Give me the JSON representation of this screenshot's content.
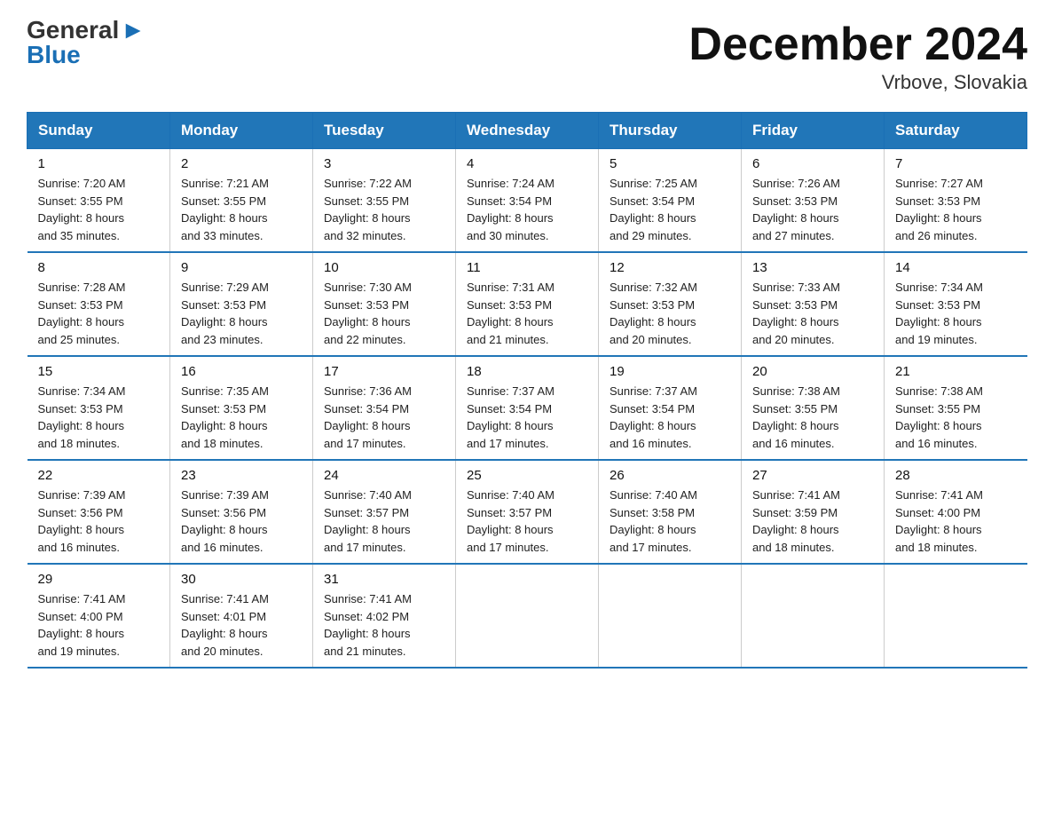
{
  "header": {
    "logo_general": "General",
    "logo_blue": "Blue",
    "month_title": "December 2024",
    "location": "Vrbove, Slovakia"
  },
  "days_of_week": [
    "Sunday",
    "Monday",
    "Tuesday",
    "Wednesday",
    "Thursday",
    "Friday",
    "Saturday"
  ],
  "weeks": [
    [
      {
        "day": "1",
        "sunrise": "7:20 AM",
        "sunset": "3:55 PM",
        "daylight": "8 hours and 35 minutes."
      },
      {
        "day": "2",
        "sunrise": "7:21 AM",
        "sunset": "3:55 PM",
        "daylight": "8 hours and 33 minutes."
      },
      {
        "day": "3",
        "sunrise": "7:22 AM",
        "sunset": "3:55 PM",
        "daylight": "8 hours and 32 minutes."
      },
      {
        "day": "4",
        "sunrise": "7:24 AM",
        "sunset": "3:54 PM",
        "daylight": "8 hours and 30 minutes."
      },
      {
        "day": "5",
        "sunrise": "7:25 AM",
        "sunset": "3:54 PM",
        "daylight": "8 hours and 29 minutes."
      },
      {
        "day": "6",
        "sunrise": "7:26 AM",
        "sunset": "3:53 PM",
        "daylight": "8 hours and 27 minutes."
      },
      {
        "day": "7",
        "sunrise": "7:27 AM",
        "sunset": "3:53 PM",
        "daylight": "8 hours and 26 minutes."
      }
    ],
    [
      {
        "day": "8",
        "sunrise": "7:28 AM",
        "sunset": "3:53 PM",
        "daylight": "8 hours and 25 minutes."
      },
      {
        "day": "9",
        "sunrise": "7:29 AM",
        "sunset": "3:53 PM",
        "daylight": "8 hours and 23 minutes."
      },
      {
        "day": "10",
        "sunrise": "7:30 AM",
        "sunset": "3:53 PM",
        "daylight": "8 hours and 22 minutes."
      },
      {
        "day": "11",
        "sunrise": "7:31 AM",
        "sunset": "3:53 PM",
        "daylight": "8 hours and 21 minutes."
      },
      {
        "day": "12",
        "sunrise": "7:32 AM",
        "sunset": "3:53 PM",
        "daylight": "8 hours and 20 minutes."
      },
      {
        "day": "13",
        "sunrise": "7:33 AM",
        "sunset": "3:53 PM",
        "daylight": "8 hours and 20 minutes."
      },
      {
        "day": "14",
        "sunrise": "7:34 AM",
        "sunset": "3:53 PM",
        "daylight": "8 hours and 19 minutes."
      }
    ],
    [
      {
        "day": "15",
        "sunrise": "7:34 AM",
        "sunset": "3:53 PM",
        "daylight": "8 hours and 18 minutes."
      },
      {
        "day": "16",
        "sunrise": "7:35 AM",
        "sunset": "3:53 PM",
        "daylight": "8 hours and 18 minutes."
      },
      {
        "day": "17",
        "sunrise": "7:36 AM",
        "sunset": "3:54 PM",
        "daylight": "8 hours and 17 minutes."
      },
      {
        "day": "18",
        "sunrise": "7:37 AM",
        "sunset": "3:54 PM",
        "daylight": "8 hours and 17 minutes."
      },
      {
        "day": "19",
        "sunrise": "7:37 AM",
        "sunset": "3:54 PM",
        "daylight": "8 hours and 16 minutes."
      },
      {
        "day": "20",
        "sunrise": "7:38 AM",
        "sunset": "3:55 PM",
        "daylight": "8 hours and 16 minutes."
      },
      {
        "day": "21",
        "sunrise": "7:38 AM",
        "sunset": "3:55 PM",
        "daylight": "8 hours and 16 minutes."
      }
    ],
    [
      {
        "day": "22",
        "sunrise": "7:39 AM",
        "sunset": "3:56 PM",
        "daylight": "8 hours and 16 minutes."
      },
      {
        "day": "23",
        "sunrise": "7:39 AM",
        "sunset": "3:56 PM",
        "daylight": "8 hours and 16 minutes."
      },
      {
        "day": "24",
        "sunrise": "7:40 AM",
        "sunset": "3:57 PM",
        "daylight": "8 hours and 17 minutes."
      },
      {
        "day": "25",
        "sunrise": "7:40 AM",
        "sunset": "3:57 PM",
        "daylight": "8 hours and 17 minutes."
      },
      {
        "day": "26",
        "sunrise": "7:40 AM",
        "sunset": "3:58 PM",
        "daylight": "8 hours and 17 minutes."
      },
      {
        "day": "27",
        "sunrise": "7:41 AM",
        "sunset": "3:59 PM",
        "daylight": "8 hours and 18 minutes."
      },
      {
        "day": "28",
        "sunrise": "7:41 AM",
        "sunset": "4:00 PM",
        "daylight": "8 hours and 18 minutes."
      }
    ],
    [
      {
        "day": "29",
        "sunrise": "7:41 AM",
        "sunset": "4:00 PM",
        "daylight": "8 hours and 19 minutes."
      },
      {
        "day": "30",
        "sunrise": "7:41 AM",
        "sunset": "4:01 PM",
        "daylight": "8 hours and 20 minutes."
      },
      {
        "day": "31",
        "sunrise": "7:41 AM",
        "sunset": "4:02 PM",
        "daylight": "8 hours and 21 minutes."
      },
      null,
      null,
      null,
      null
    ]
  ],
  "labels": {
    "sunrise": "Sunrise:",
    "sunset": "Sunset:",
    "daylight": "Daylight:"
  }
}
